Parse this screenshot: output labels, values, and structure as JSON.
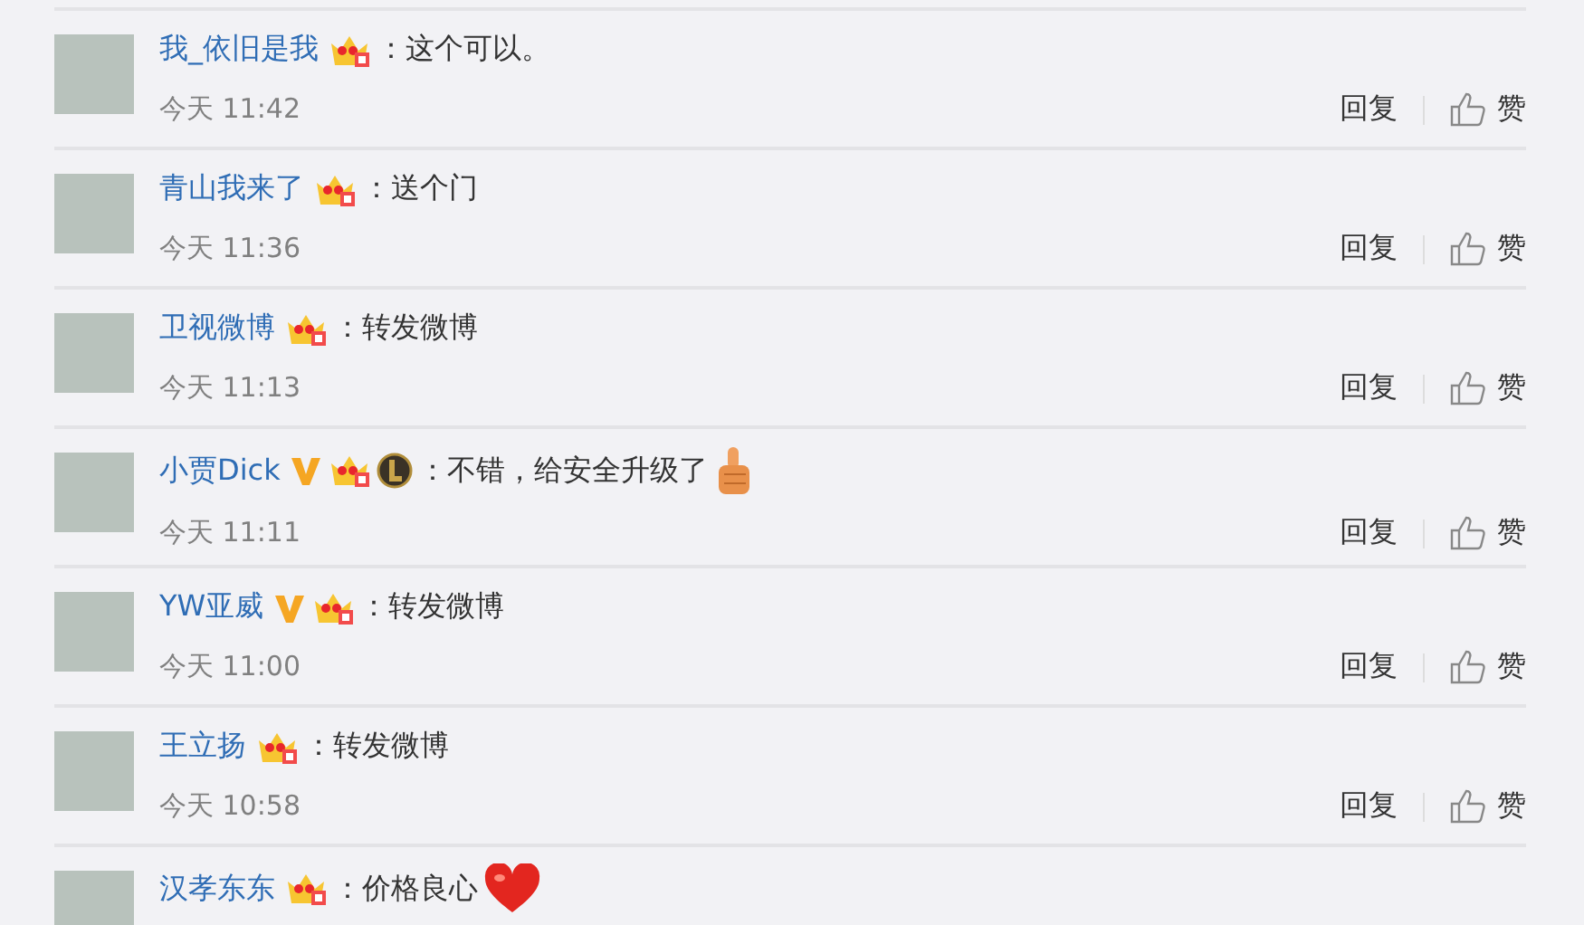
{
  "comments": [
    {
      "name": "我_依旧是我",
      "badges": [
        {
          "kind": "crown"
        }
      ],
      "text": "：这个可以。",
      "time": "今天 11:42",
      "reply": "回复",
      "like": "赞"
    },
    {
      "name": "青山我来了",
      "badges": [
        {
          "kind": "crown"
        }
      ],
      "text": "：送个门",
      "time": "今天 11:36",
      "reply": "回复",
      "like": "赞"
    },
    {
      "name": "卫视微博",
      "badges": [
        {
          "kind": "crown"
        }
      ],
      "text": "：转发微博",
      "time": "今天 11:13",
      "reply": "回复",
      "like": "赞"
    },
    {
      "name": "小贾Dick",
      "badges": [
        {
          "kind": "verified"
        },
        {
          "kind": "crown"
        },
        {
          "kind": "game"
        }
      ],
      "text": "：不错，给安全升级了",
      "emoji": {
        "kind": "thumb"
      },
      "time": "今天 11:11",
      "reply": "回复",
      "like": "赞"
    },
    {
      "name": "YW亚威",
      "badges": [
        {
          "kind": "verified"
        },
        {
          "kind": "crown"
        }
      ],
      "text": "：转发微博",
      "time": "今天 11:00",
      "reply": "回复",
      "like": "赞"
    },
    {
      "name": "王立扬",
      "badges": [
        {
          "kind": "crown"
        }
      ],
      "text": "：转发微博",
      "time": "今天 10:58",
      "reply": "回复",
      "like": "赞"
    },
    {
      "name": "汉孝东东",
      "badges": [
        {
          "kind": "crown"
        }
      ],
      "text": "：价格良心",
      "emoji": {
        "kind": "heart"
      }
    }
  ]
}
